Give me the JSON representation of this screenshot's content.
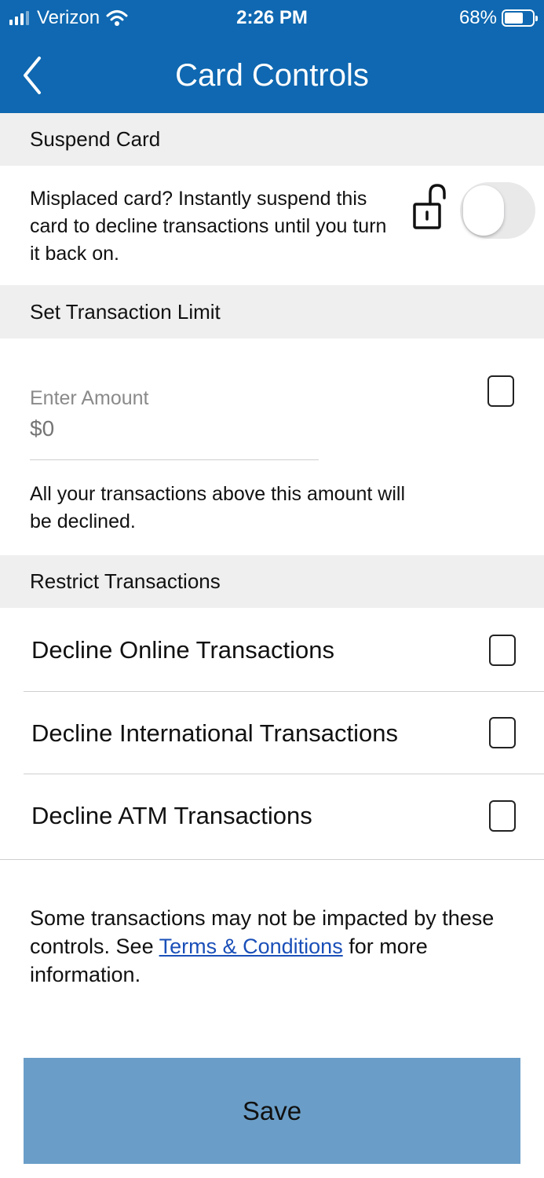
{
  "status_bar": {
    "carrier": "Verizon",
    "time": "2:26 PM",
    "battery": "68%",
    "battery_level": 0.68
  },
  "nav": {
    "title": "Card Controls",
    "back_icon": "chevron-left-icon"
  },
  "suspend": {
    "heading": "Suspend Card",
    "description": "Misplaced card? Instantly suspend this card to decline transactions until you turn it back on.",
    "lock_icon": "unlocked-padlock-icon",
    "toggle_on": false
  },
  "limit": {
    "heading": "Set Transaction Limit",
    "amount_label": "Enter Amount",
    "amount_placeholder": "$0",
    "checked": false,
    "note": "All your transactions above this amount will be declined."
  },
  "restrict": {
    "heading": "Restrict Transactions",
    "items": [
      {
        "label": "Decline Online Transactions",
        "checked": false
      },
      {
        "label": "Decline International Transactions",
        "checked": false
      },
      {
        "label": "Decline ATM Transactions",
        "checked": false
      }
    ]
  },
  "footer_note": {
    "before": "Some transactions may not be impacted by these controls. See ",
    "link": "Terms & Conditions",
    "after": " for more information."
  },
  "save_label": "Save",
  "colors": {
    "header": "#0f68b1",
    "section_bg": "#efefef",
    "save_button": "#6a9ec8",
    "link": "#1a4fb8"
  }
}
